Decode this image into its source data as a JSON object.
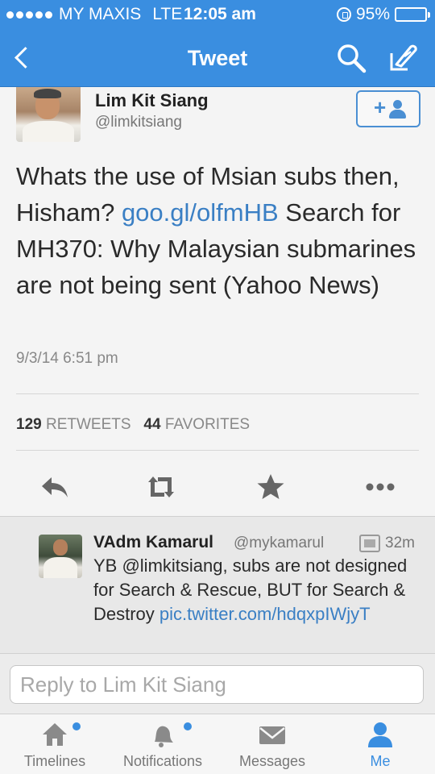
{
  "status_bar": {
    "carrier": "MY MAXIS",
    "network": "LTE",
    "time": "12:05 am",
    "battery": "95%",
    "battery_level": 0.95
  },
  "nav": {
    "title": "Tweet",
    "icons": [
      "back-icon",
      "search-icon",
      "compose-icon"
    ]
  },
  "tweet": {
    "author_name": "Lim Kit Siang",
    "author_handle": "@limkitsiang",
    "text_part1": "Whats the use of Msian subs then, Hisham? ",
    "link": "goo.gl/olfmHB",
    "text_part2": " Search for MH370: Why Malaysian submarines are not being sent (Yahoo News)",
    "timestamp": "9/3/14 6:51 pm",
    "retweets_count": "129",
    "retweets_label": "RETWEETS",
    "favorites_count": "44",
    "favorites_label": "FAVORITES",
    "actions": [
      "reply-icon",
      "retweet-icon",
      "favorite-icon",
      "more-icon"
    ]
  },
  "reply": {
    "author_name": "VAdm Kamarul",
    "author_handle": "@mykamarul",
    "time": "32m",
    "text": "YB @limkitsiang, subs are not designed for Search & Rescue, BUT for Search & Destroy ",
    "link": "pic.twitter.com/hdqxpIWjyT"
  },
  "reply_input": {
    "placeholder": "Reply to Lim Kit Siang"
  },
  "tabs": [
    {
      "label": "Timelines",
      "icon": "home-icon",
      "has_dot": true,
      "active": false
    },
    {
      "label": "Notifications",
      "icon": "bell-icon",
      "has_dot": true,
      "active": false
    },
    {
      "label": "Messages",
      "icon": "envelope-icon",
      "has_dot": false,
      "active": false
    },
    {
      "label": "Me",
      "icon": "person-icon",
      "has_dot": false,
      "active": true
    }
  ],
  "colors": {
    "brand": "#3a8ee0",
    "link": "#3a7fc4"
  }
}
